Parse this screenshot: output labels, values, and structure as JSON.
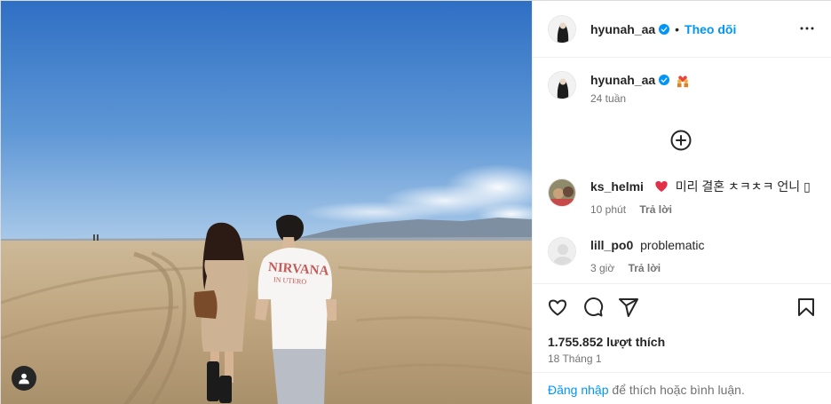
{
  "post": {
    "username": "hyunah_aa",
    "follow_label": "Theo dõi",
    "dot": "•",
    "caption_age": "24 tuần",
    "likes_text": "1.755.852 lượt thích",
    "date": "18 Tháng 1",
    "login_link": "Đăng nhập",
    "login_rest": " để thích hoặc bình luận."
  },
  "comments": [
    {
      "username": "ks_helmi",
      "text": "미리 결혼 ㅊㅋㅊㅋ 언니 ▯",
      "time": "10 phút",
      "reply": "Trả lời"
    },
    {
      "username": "lill_po0",
      "text": "problematic",
      "time": "3 giờ",
      "reply": "Trả lời"
    }
  ],
  "colors": {
    "accent": "#0095f6",
    "text": "#262626",
    "muted": "#737373",
    "heart": "#ed4956"
  },
  "icons": [
    "more-horizontal-icon",
    "verified-badge-icon",
    "add-circle-icon",
    "heart-icon",
    "comment-icon",
    "share-icon",
    "bookmark-icon",
    "user-tag-icon"
  ]
}
